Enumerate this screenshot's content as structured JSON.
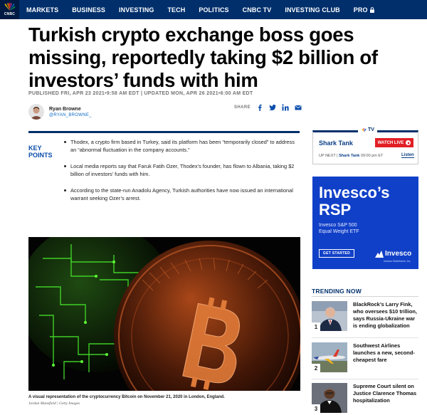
{
  "nav": {
    "logo_text": "CNBC",
    "items": [
      "MARKETS",
      "BUSINESS",
      "INVESTING",
      "TECH",
      "POLITICS",
      "CNBC TV",
      "INVESTING CLUB",
      "PRO"
    ]
  },
  "article": {
    "headline": "Turkish crypto exchange boss goes missing, reportedly taking $2 billion of investors’ funds with him",
    "dateline": "PUBLISHED FRI, APR 23 2021•9:58 AM EDT | UPDATED MON, APR 26 2021•6:00 AM EDT",
    "author_name": "Ryan Browne",
    "author_handle": "@RYAN_BROWNE_",
    "share_label": "SHARE",
    "key_points_label_1": "KEY",
    "key_points_label_2": "POINTS",
    "key_points": [
      "Thodex, a crypto firm based in Turkey, said its platform has been “temporarily closed” to address an “abnormal fluctuation in the company accounts.”",
      "Local media reports say that Faruk Fatih Ozer, Thodex’s founder, has flown to Albania, taking $2 billion of investors’ funds with him.",
      "According to the state-run Anadolu Agency, Turkish authorities have now issued an international warrant seeking Ozer’s arrest."
    ],
    "image_caption": "A visual representation of the cryptocurrency Bitcoin on November 21, 2020 in London, England.",
    "image_credit": "Jordan Mansfield | Getty Images"
  },
  "tv": {
    "logo": "TV",
    "show": "Shark Tank",
    "watch_label": "WATCH LIVE",
    "up_next_prefix": "UP NEXT | ",
    "up_next_show": "Shark Tank",
    "up_next_time": " 09:00 pm ET",
    "listen_label": "Listen"
  },
  "ad": {
    "title_line1": "Invesco’s",
    "title_line2": "RSP",
    "sub_line1": "Invesco S&P 500",
    "sub_line2": "Equal Weight ETF",
    "button": "GET STARTED",
    "brand": "Invesco",
    "fine_print": "Invesco Distributors, Inc.",
    "color": "#1140c8"
  },
  "trending": {
    "title": "TRENDING NOW",
    "items": [
      {
        "rank": "1",
        "text": "BlackRock’s Larry Fink, who oversees $10 trillion, says Russia-Ukraine war is ending globalization"
      },
      {
        "rank": "2",
        "text": "Southwest Airlines launches a new, second-cheapest fare"
      },
      {
        "rank": "3",
        "text": "Supreme Court silent on Justice Clarence Thomas hospitalization"
      }
    ]
  },
  "colors": {
    "nav_bg": "#002f6c",
    "accent_blue": "#0a4dab",
    "live_red": "#e11f26"
  }
}
